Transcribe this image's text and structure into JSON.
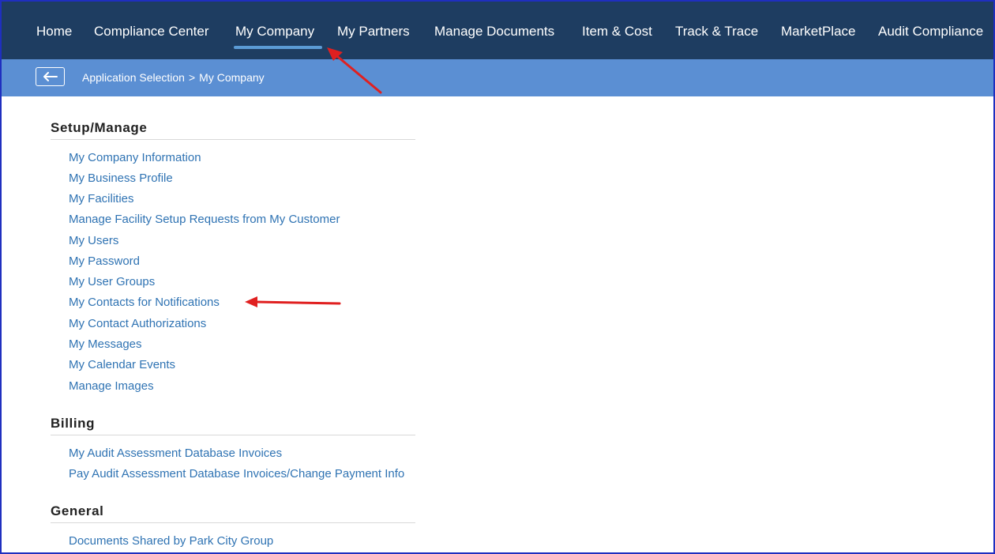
{
  "topnav": {
    "items": [
      {
        "label": "Home"
      },
      {
        "label": "Compliance Center"
      },
      {
        "label": "My Company"
      },
      {
        "label": "My Partners"
      },
      {
        "label": "Manage Documents"
      },
      {
        "label": "Item & Cost"
      },
      {
        "label": "Track & Trace"
      },
      {
        "label": "MarketPlace"
      },
      {
        "label": "Audit Compliance"
      }
    ],
    "active": "My Company"
  },
  "breadcrumb": {
    "back_icon": "left-arrow-icon",
    "root": "Application Selection",
    "separator": ">",
    "current": "My Company"
  },
  "sections": [
    {
      "title": "Setup/Manage",
      "links": [
        "My Company Information",
        "My Business Profile",
        "My Facilities",
        "Manage Facility Setup Requests from My Customer",
        "My Users",
        "My Password",
        "My User Groups",
        "My Contacts for Notifications",
        "My Contact Authorizations",
        "My Messages",
        "My Calendar Events",
        "Manage Images"
      ]
    },
    {
      "title": "Billing",
      "links": [
        "My Audit Assessment Database Invoices",
        "Pay Audit Assessment Database Invoices/Change Payment Info"
      ]
    },
    {
      "title": "General",
      "links": [
        "Documents Shared by Park City Group"
      ]
    }
  ],
  "colors": {
    "nav_bg": "#1e3d61",
    "subbar_bg": "#5b8fd3",
    "link": "#2f73b3",
    "annotation_arrow": "#e02020"
  }
}
